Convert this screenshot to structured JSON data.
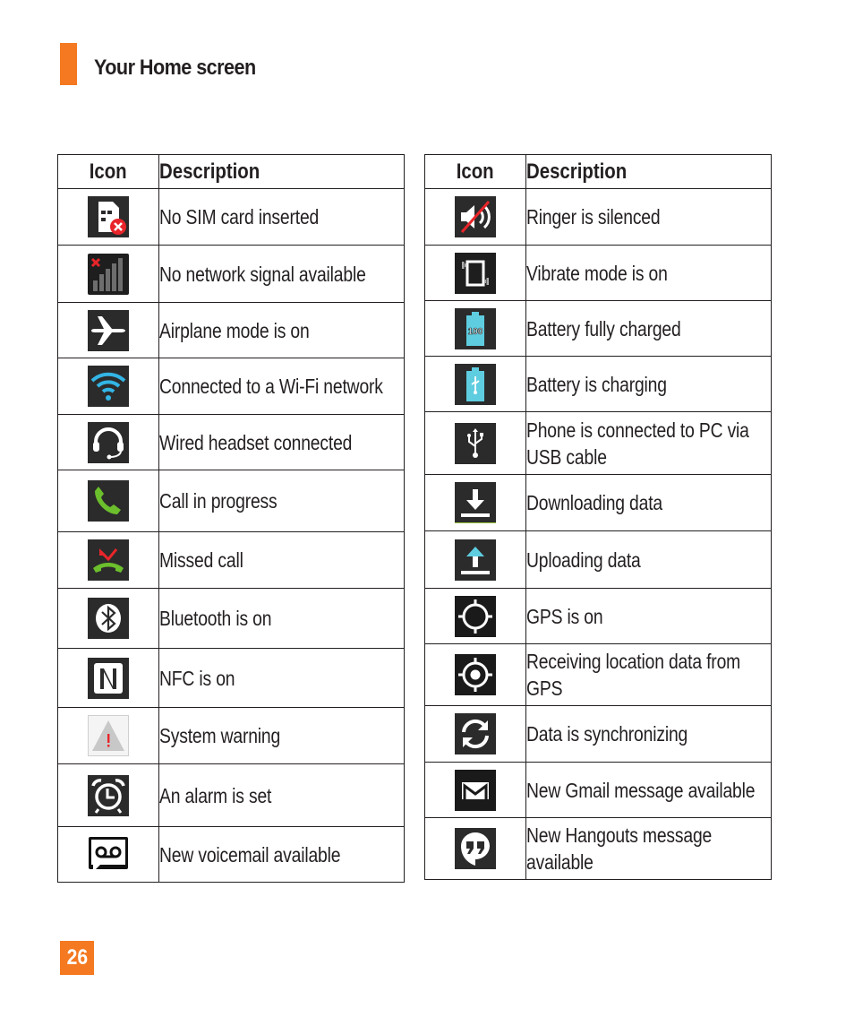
{
  "section": {
    "title": "Your Home screen",
    "accent_color": "#f47920"
  },
  "page_number": "26",
  "tables": {
    "left": {
      "headers": {
        "icon": "Icon",
        "description": "Description"
      },
      "rows": [
        {
          "icon": "no-sim-icon",
          "description": "No SIM card inserted"
        },
        {
          "icon": "no-signal-icon",
          "description": "No network signal available"
        },
        {
          "icon": "airplane-icon",
          "description": "Airplane mode is on"
        },
        {
          "icon": "wifi-icon",
          "description": "Connected to a Wi-Fi network"
        },
        {
          "icon": "headset-icon",
          "description": "Wired headset connected"
        },
        {
          "icon": "call-icon",
          "description": "Call in progress"
        },
        {
          "icon": "missed-call-icon",
          "description": "Missed call"
        },
        {
          "icon": "bluetooth-icon",
          "description": "Bluetooth is on"
        },
        {
          "icon": "nfc-icon",
          "description": "NFC is on"
        },
        {
          "icon": "warning-icon",
          "description": "System warning"
        },
        {
          "icon": "alarm-icon",
          "description": "An alarm is set"
        },
        {
          "icon": "voicemail-icon",
          "description": "New voicemail available"
        }
      ]
    },
    "right": {
      "headers": {
        "icon": "Icon",
        "description": "Description"
      },
      "rows": [
        {
          "icon": "ringer-silenced-icon",
          "description": "Ringer is silenced"
        },
        {
          "icon": "vibrate-icon",
          "description": "Vibrate mode is on"
        },
        {
          "icon": "battery-full-icon",
          "description": "Battery fully charged",
          "icon_text": "100"
        },
        {
          "icon": "battery-charging-icon",
          "description": "Battery is charging"
        },
        {
          "icon": "usb-icon",
          "description": "Phone is connected to PC via USB cable"
        },
        {
          "icon": "download-icon",
          "description": "Downloading data"
        },
        {
          "icon": "upload-icon",
          "description": "Uploading data"
        },
        {
          "icon": "gps-icon",
          "description": "GPS is on"
        },
        {
          "icon": "gps-receiving-icon",
          "description": "Receiving location data from GPS"
        },
        {
          "icon": "sync-icon",
          "description": "Data is synchronizing"
        },
        {
          "icon": "gmail-icon",
          "description": "New Gmail message available"
        },
        {
          "icon": "hangouts-icon",
          "description": "New Hangouts message available"
        }
      ]
    }
  },
  "colors": {
    "icon_bg": "#2b2b2b",
    "wifi_blue": "#33b5e5",
    "call_green": "#6cbf2c",
    "alert_red": "#e8252a",
    "battery_blue": "#5ecde0"
  }
}
